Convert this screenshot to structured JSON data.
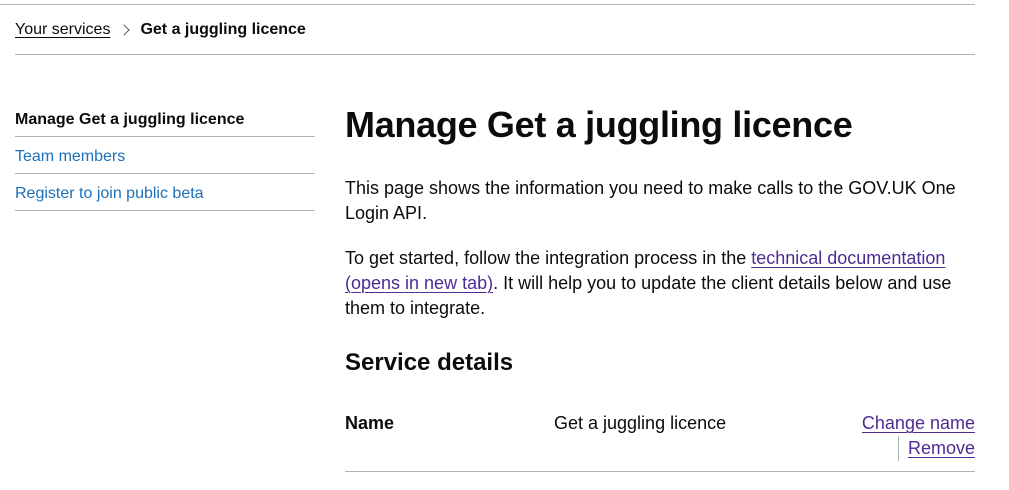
{
  "breadcrumb": {
    "parent": "Your services",
    "current": "Get a juggling licence"
  },
  "sidenav": {
    "items": [
      {
        "label": "Manage Get a juggling licence",
        "active": true
      },
      {
        "label": "Team members",
        "active": false
      },
      {
        "label": "Register to join public beta",
        "active": false
      }
    ]
  },
  "main": {
    "title": "Manage Get a juggling licence",
    "intro": "This page shows the information you need to make calls to the GOV.UK One Login API.",
    "getting_started_prefix": "To get started, follow the integration process in the ",
    "getting_started_link": "technical documentation (opens in new tab)",
    "getting_started_suffix": ". It will help you to update the client details below and use them to integrate.",
    "service_details_heading": "Service details",
    "summary": {
      "name_key": "Name",
      "name_value": "Get a juggling licence",
      "change_action": "Change name",
      "remove_action": "Remove"
    }
  },
  "colors": {
    "text": "#0b0c0c",
    "link": "#1d70b8",
    "visited_link": "#4c2c92",
    "border": "#b1b4b6"
  }
}
